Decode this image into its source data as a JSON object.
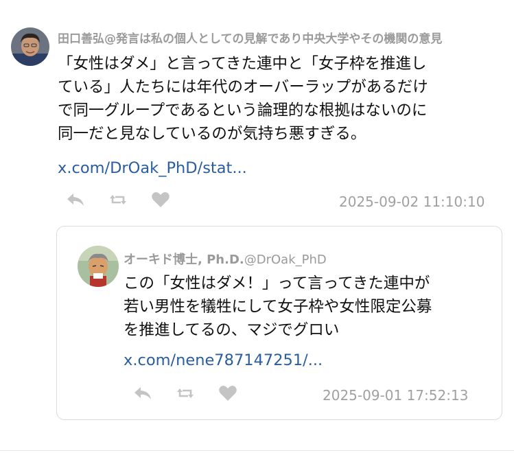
{
  "main": {
    "author_line": "田口善弘@発言は私の個人としての見解であり中央大学やその機関の意見",
    "text_lines": [
      "「女性はダメ」と言ってきた連中と「女子枠を推進し",
      "ている」人たちには年代のオーバーラップがあるだけ",
      "で同一グループであるという論理的な根拠はないのに",
      "同一だと見なしているのが気持ち悪すぎる。"
    ],
    "link": "x.com/DrOak_PhD/stat...",
    "timestamp": "2025-09-02 11:10:10",
    "actions": [
      "reply-icon",
      "retweet-icon",
      "like-icon"
    ]
  },
  "quote": {
    "author_name": "オーキド博士, Ph.D.",
    "author_handle": "@DrOak_PhD",
    "text_lines": [
      "この「女性はダメ！」って言ってきた連中が",
      "若い男性を犠牲にして女子枠や女性限定公募",
      "を推進してるの、マジでグロい"
    ],
    "link": "x.com/nene787147251/...",
    "timestamp": "2025-09-01 17:52:13",
    "actions": [
      "reply-icon",
      "retweet-icon",
      "like-icon"
    ]
  },
  "colors": {
    "link": "#2a5d9f",
    "meta_gray": "#a0a0a0",
    "icon_gray": "#c4c4c4",
    "card_border": "#dcdcdc"
  }
}
